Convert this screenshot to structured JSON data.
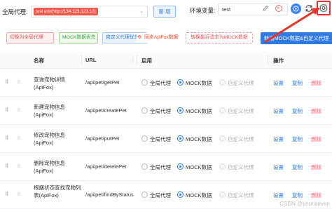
{
  "proxy_bar": {
    "label": "全局代理:",
    "env_tag": "test env(http://134.123.123.10)",
    "new_button": "新 增",
    "env_var_label": "环境变量:",
    "env_var_value": "test"
  },
  "icons": {
    "edit": "edit-icon",
    "clear": "close-circle-icon",
    "run": "play-icon",
    "refresh": "refresh-icon",
    "settings": "gear-icon",
    "drag": "drag-handle-icon",
    "star": "star-icon",
    "sync": "sync-icon"
  },
  "actions_bar": {
    "switch_global": "切换为全局代理",
    "mock_first": "MOCK数据优先",
    "custom_first": "自定义代理优先",
    "sync_apifox": "同步ApiFox数据",
    "switch_recent": "转换最近请求为MOCK数据",
    "add_mock": "新增MOCK数据&自定义代理"
  },
  "table": {
    "headers": {
      "name": "名称",
      "url": "URL",
      "enable": "启用",
      "ops": "操作"
    },
    "options": {
      "global": "全局代理",
      "mock": "MOCK数据",
      "custom": "自定义代理"
    },
    "op_labels": {
      "set": "设置",
      "copy": "复制",
      "delete": "删除"
    },
    "rows": [
      {
        "name": "查询宠物详情 (ApiFox)",
        "url": "/api/pet/getPet"
      },
      {
        "name": "新建宠物信息 (ApiFox)",
        "url": "/api/pet/createPet"
      },
      {
        "name": "修改宠物信息 (ApiFox)",
        "url": "/api/pet/putPet"
      },
      {
        "name": "删除宠物信息 (ApiFox)",
        "url": "/api/pet/detelePet"
      },
      {
        "name": "根据状态查找宠物列表(ApiFox)",
        "url": "/api/pet/findByStatus"
      }
    ]
  },
  "colors": {
    "primary": "#2f7ae5",
    "danger": "#f56c6c",
    "annotation": "#e8322b"
  },
  "watermark": "CSDN @shunseven"
}
